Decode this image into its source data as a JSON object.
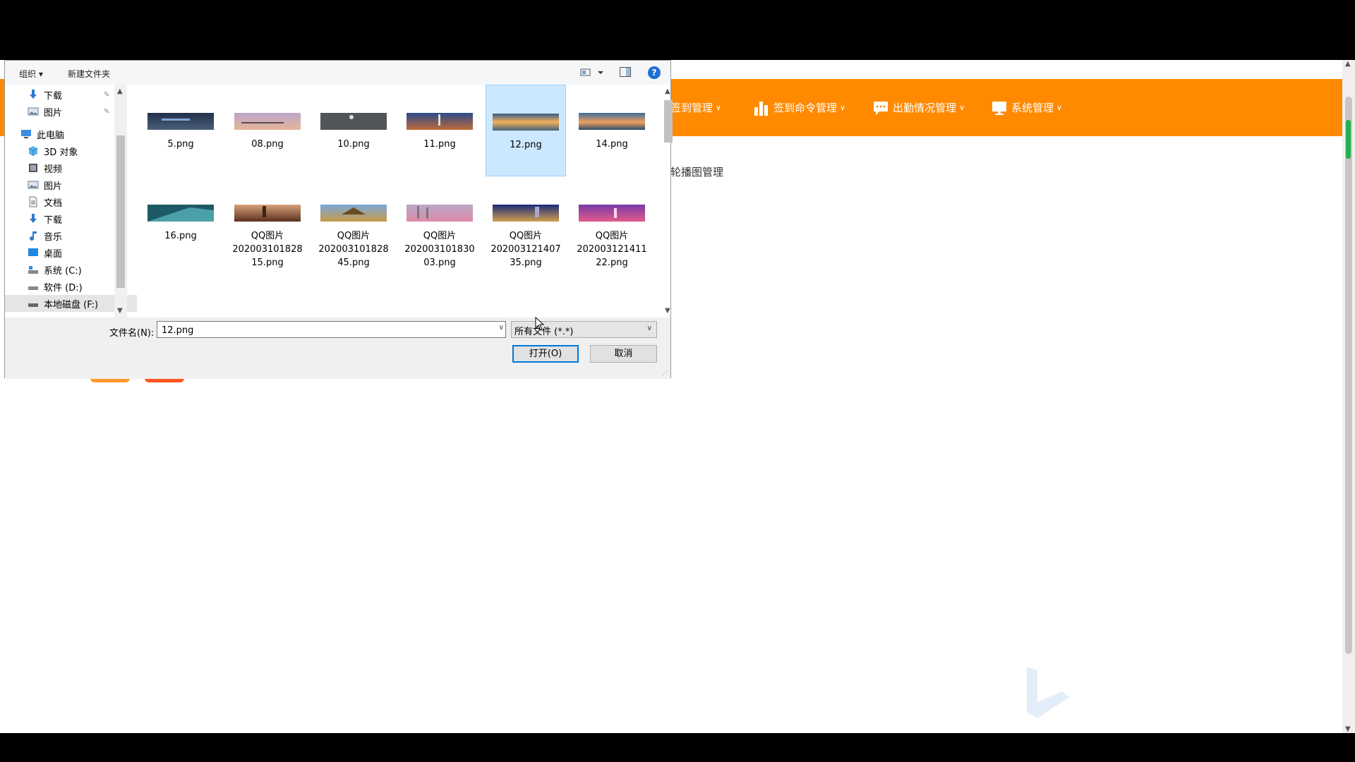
{
  "dialog": {
    "toolbar": {
      "organize": "组织 ▾",
      "new_folder": "新建文件夹"
    },
    "nav_items": [
      {
        "label": "下载",
        "icon": "download-icon",
        "pinned": true
      },
      {
        "label": "图片",
        "icon": "pictures-icon",
        "pinned": true
      },
      {
        "label": "此电脑",
        "icon": "this-pc-icon"
      },
      {
        "label": "3D 对象",
        "icon": "3d-objects-icon"
      },
      {
        "label": "视频",
        "icon": "video-icon"
      },
      {
        "label": "图片",
        "icon": "pictures-icon"
      },
      {
        "label": "文档",
        "icon": "documents-icon"
      },
      {
        "label": "下载",
        "icon": "download-icon"
      },
      {
        "label": "音乐",
        "icon": "music-icon"
      },
      {
        "label": "桌面",
        "icon": "desktop-icon"
      },
      {
        "label": "系统 (C:)",
        "icon": "system-drive-icon"
      },
      {
        "label": "软件 (D:)",
        "icon": "drive-icon"
      },
      {
        "label": "本地磁盘 (F:)",
        "icon": "drive-icon",
        "selected": true
      }
    ],
    "files": [
      {
        "name": "5.png"
      },
      {
        "name": "08.png"
      },
      {
        "name": "10.png"
      },
      {
        "name": "11.png"
      },
      {
        "name": "12.png",
        "selected": true
      },
      {
        "name": "14.png"
      },
      {
        "name": "16.png"
      },
      {
        "name": "QQ图片\n202003101828\n15.png"
      },
      {
        "name": "QQ图片\n202003101828\n45.png"
      },
      {
        "name": "QQ图片\n202003101830\n03.png"
      },
      {
        "name": "QQ图片\n202003121407\n35.png"
      },
      {
        "name": "QQ图片\n202003121411\n22.png"
      }
    ],
    "filename_label": "文件名(N):",
    "filename_value": "12.png",
    "filetype_value": "所有文件 (*.*)",
    "open_label": "打开(O)",
    "cancel_label": "取消"
  },
  "page": {
    "nav_items": [
      {
        "label": "签到管理",
        "icon": "hidden-icon"
      },
      {
        "label": "签到命令管理",
        "icon": "bar-chart-icon"
      },
      {
        "label": "出勤情况管理",
        "icon": "chat-icon"
      },
      {
        "label": "系统管理",
        "icon": "monitor-icon"
      }
    ],
    "content_text": "轮播图管理",
    "colors": {
      "nav": "#ff8a00"
    }
  }
}
